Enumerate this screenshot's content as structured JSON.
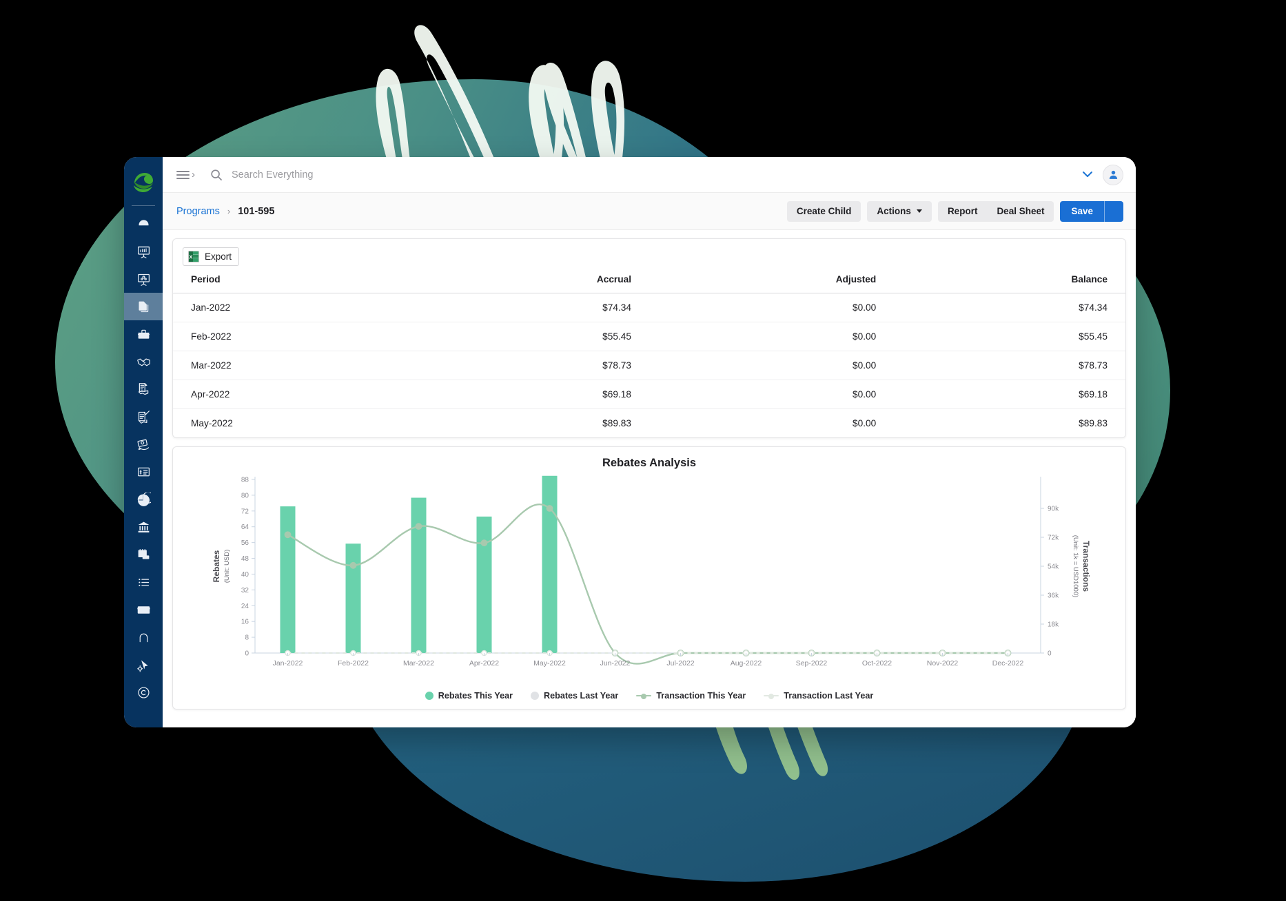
{
  "app": {
    "logo_name": "leaf-logo"
  },
  "sidebar": {
    "items": [
      {
        "icon": "dashboard-gauge-icon",
        "name": "sidebar-item-dashboard",
        "active": false
      },
      {
        "icon": "presentation-chart-icon",
        "name": "sidebar-item-analytics",
        "active": false
      },
      {
        "icon": "presentation-share-icon",
        "name": "sidebar-item-presentations",
        "active": false
      },
      {
        "icon": "documents-copy-icon",
        "name": "sidebar-item-programs",
        "active": true
      },
      {
        "icon": "briefcase-icon",
        "name": "sidebar-item-portfolio",
        "active": false
      },
      {
        "icon": "handshake-icon",
        "name": "sidebar-item-deals",
        "active": false
      },
      {
        "icon": "contract-hand-icon",
        "name": "sidebar-item-contracts",
        "active": false
      },
      {
        "icon": "document-check-hand-icon",
        "name": "sidebar-item-approvals",
        "active": false
      },
      {
        "icon": "money-return-icon",
        "name": "sidebar-item-rebates",
        "active": false
      },
      {
        "icon": "invoice-icon",
        "name": "sidebar-item-invoices",
        "active": false
      },
      {
        "icon": "pie-chart-icon",
        "name": "sidebar-item-reports",
        "active": false
      },
      {
        "icon": "bank-icon",
        "name": "sidebar-item-finance",
        "active": false
      },
      {
        "icon": "calendar-card-icon",
        "name": "sidebar-item-calendar",
        "active": false
      },
      {
        "icon": "list-icon",
        "name": "sidebar-item-lists",
        "active": false
      },
      {
        "icon": "credit-card-icon",
        "name": "sidebar-item-payments",
        "active": false
      },
      {
        "icon": "arch-icon",
        "name": "sidebar-item-structures",
        "active": false
      },
      {
        "icon": "settings-cursor-icon",
        "name": "sidebar-item-settings",
        "active": false
      },
      {
        "icon": "copyright-icon",
        "name": "sidebar-item-about",
        "active": false
      }
    ]
  },
  "topbar": {
    "menu_icon": "hamburger-expand-icon",
    "search_icon": "search-icon",
    "search_value": "",
    "search_placeholder": "Search Everything",
    "chevron_icon": "chevron-down-icon",
    "avatar_icon": "user-avatar-icon"
  },
  "breadcrumb": {
    "parent": "Programs",
    "separator": "›",
    "current": "101-595"
  },
  "toolbar": {
    "create_child": "Create Child",
    "actions": "Actions",
    "report": "Report",
    "deal_sheet": "Deal Sheet",
    "save": "Save"
  },
  "table_card": {
    "export_label": "Export",
    "export_icon": "excel-file-icon",
    "columns": [
      "Period",
      "Accrual",
      "Adjusted",
      "Balance"
    ],
    "rows": [
      [
        "Jan-2022",
        "$74.34",
        "$0.00",
        "$74.34"
      ],
      [
        "Feb-2022",
        "$55.45",
        "$0.00",
        "$55.45"
      ],
      [
        "Mar-2022",
        "$78.73",
        "$0.00",
        "$78.73"
      ],
      [
        "Apr-2022",
        "$69.18",
        "$0.00",
        "$69.18"
      ],
      [
        "May-2022",
        "$89.83",
        "$0.00",
        "$89.83"
      ]
    ]
  },
  "colors": {
    "brand_navy": "#07335f",
    "primary_blue": "#1a6fd4",
    "link_blue": "#1a73d4",
    "bar_green": "#69d2ac",
    "line_sage": "#a8c9ae",
    "line_last_year": "#dfe7df",
    "dot_grey": "#d8dadd",
    "logo_green": "#3faa35"
  },
  "chart_data": {
    "type": "bar",
    "title": "Rebates Analysis",
    "xlabel": "",
    "ylabel": "Rebates",
    "ylabel_unit": "(Unit: USD)",
    "y2label": "Transactions",
    "y2label_unit": "(Unit: 1k = USD1000)",
    "grid": false,
    "legend_position": "bottom",
    "categories": [
      "Jan-2022",
      "Feb-2022",
      "Mar-2022",
      "Apr-2022",
      "May-2022",
      "Jun-2022",
      "Jul-2022",
      "Aug-2022",
      "Sep-2022",
      "Oct-2022",
      "Nov-2022",
      "Dec-2022"
    ],
    "ylim": [
      0,
      88
    ],
    "yticks": [
      0,
      8,
      16,
      24,
      32,
      40,
      48,
      56,
      64,
      72,
      80,
      88
    ],
    "y2lim": [
      0,
      108000
    ],
    "y2ticks": [
      0,
      18000,
      36000,
      54000,
      72000,
      90000
    ],
    "y2ticklabels": [
      "0",
      "18k",
      "36k",
      "54k",
      "72k",
      "90k"
    ],
    "series": [
      {
        "name": "Rebates This Year",
        "kind": "bar",
        "axis": "left",
        "color": "#69d2ac",
        "values": [
          74.34,
          55.45,
          78.73,
          69.18,
          89.83,
          0,
          0,
          0,
          0,
          0,
          0,
          0
        ]
      },
      {
        "name": "Rebates Last Year",
        "kind": "bar",
        "axis": "left",
        "color": "#d8dadd",
        "values": [
          0,
          0,
          0,
          0,
          0,
          0,
          0,
          0,
          0,
          0,
          0,
          0
        ]
      },
      {
        "name": "Transaction This Year",
        "kind": "line",
        "axis": "right",
        "color": "#a8c9ae",
        "values": [
          73600,
          54500,
          78800,
          68500,
          90000,
          0,
          0,
          0,
          0,
          0,
          0,
          0
        ]
      },
      {
        "name": "Transaction Last Year",
        "kind": "line",
        "axis": "right",
        "color": "#dfe7df",
        "values": [
          0,
          0,
          0,
          0,
          0,
          0,
          0,
          0,
          0,
          0,
          0,
          0
        ]
      }
    ]
  }
}
